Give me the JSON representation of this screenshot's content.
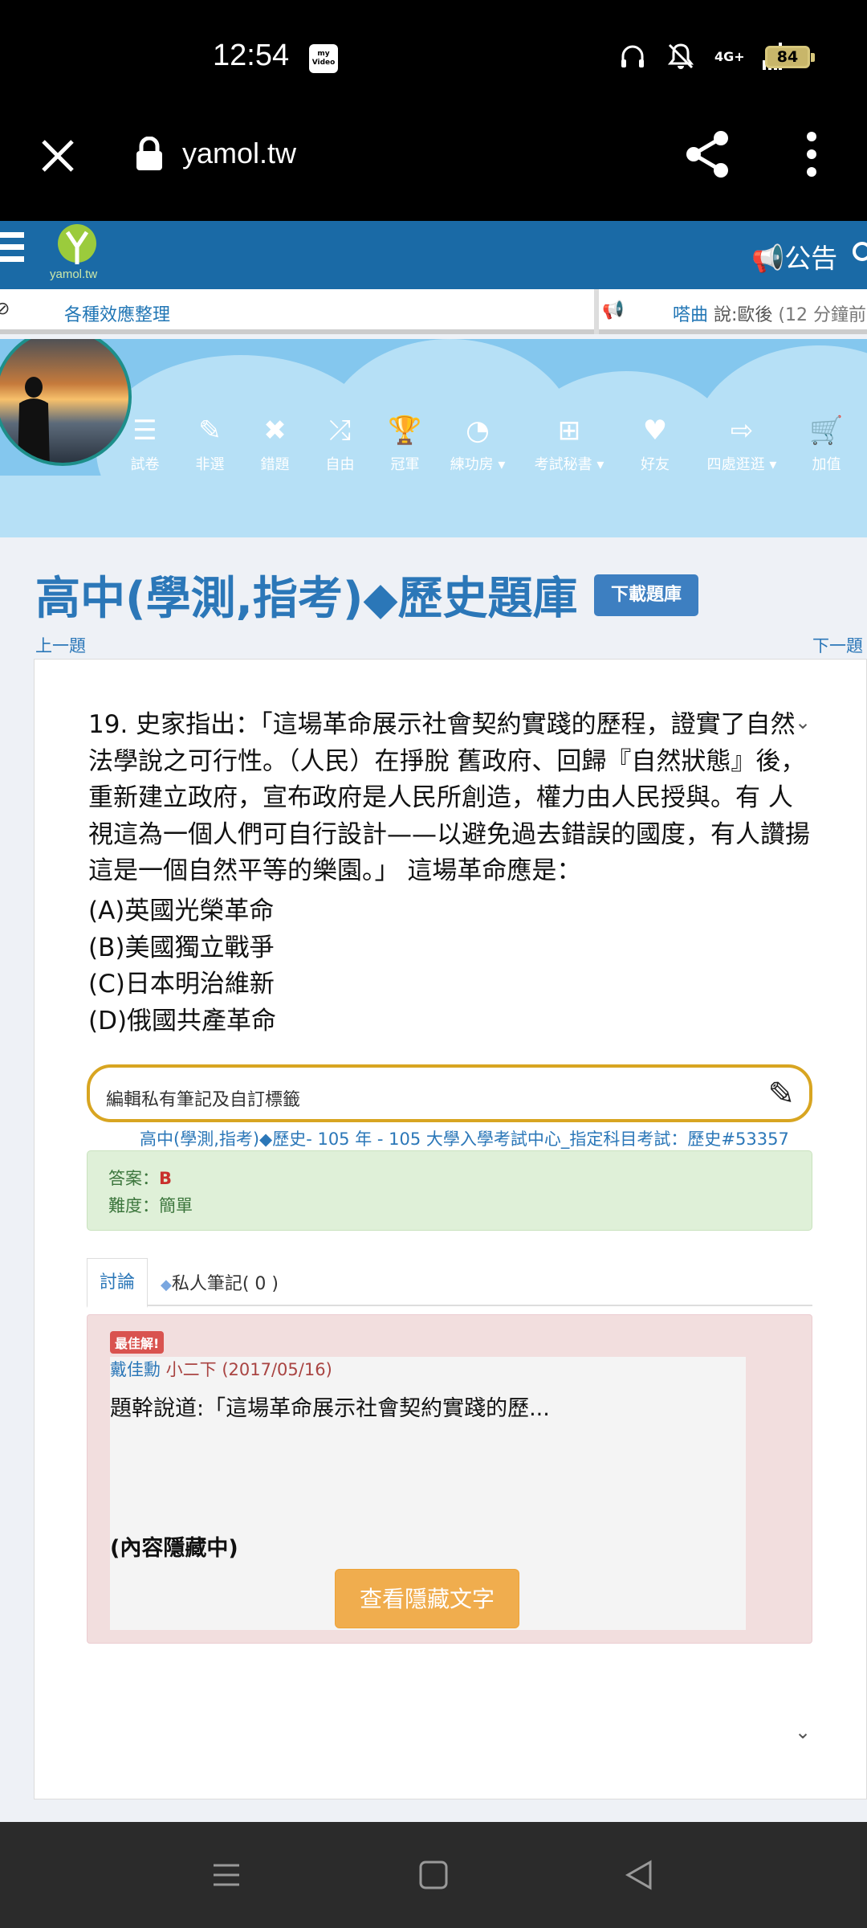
{
  "status_bar": {
    "time": "12:54",
    "app_badge": "my Video",
    "network": "4G+",
    "battery": "84"
  },
  "browser": {
    "url": "yamol.tw"
  },
  "site_header": {
    "logo_text": "yamol.tw",
    "notice_label": "公告"
  },
  "ticker": {
    "left_link": "各種效應整理",
    "user": "嗒曲",
    "message": " 說:歐後",
    "time_ago": " (12 分鐘前)"
  },
  "nav": [
    {
      "label": "試卷",
      "icon": "menu-icon"
    },
    {
      "label": "非選",
      "icon": "pencil-icon"
    },
    {
      "label": "錯題",
      "icon": "close-icon"
    },
    {
      "label": "自由",
      "icon": "shuffle-icon"
    },
    {
      "label": "冠軍",
      "icon": "trophy-icon"
    },
    {
      "label": "練功房 ▾",
      "icon": "gauge-icon"
    },
    {
      "label": "考試秘書 ▾",
      "icon": "medkit-icon"
    },
    {
      "label": "好友",
      "icon": "heart-icon"
    },
    {
      "label": "四處逛逛 ▾",
      "icon": "signout-icon"
    },
    {
      "label": "加值",
      "icon": "cart-icon"
    }
  ],
  "page": {
    "title": "高中(學測,指考)◆歷史題庫",
    "download_button": "下載題庫",
    "prev": "上一題",
    "next": "下一題"
  },
  "question": {
    "text": "19. 史家指出：「這場革命展示社會契約實踐的歷程，證實了自然法學說之可行性。（人民）在掙脫 舊政府、回歸『自然狀態』後，重新建立政府，宣布政府是人民所創造，權力由人民授與。有 人視這為一個人們可自行設計——以避免過去錯誤的國度，有人讚揚這是一個自然平等的樂園。」 這場革命應是：",
    "options": [
      "(A)英國光榮革命",
      "(B)美國獨立戰爭",
      "(C)日本明治維新",
      "(D)俄國共產革命"
    ]
  },
  "note": {
    "placeholder": "編輯私有筆記及自訂標籤"
  },
  "source": "高中(學測,指考)◆歷史- 105 年 - 105 大學入學考試中心_指定科目考試：歷史#53357",
  "answer": {
    "answer_label": "答案：",
    "answer_value": "B",
    "difficulty_label": "難度：",
    "difficulty_value": "簡單"
  },
  "tabs": {
    "discussion": "討論",
    "private_notes": "私人筆記( 0 )"
  },
  "discussion": {
    "badge": "最佳解!",
    "author": "戴佳勳",
    "author_meta": " 小二下 (2017/05/16)",
    "excerpt": "題幹說道:「這場革命展示社會契約實踐的歷...",
    "hidden_label": "(內容隱藏中)",
    "reveal_button": "查看隱藏文字"
  }
}
